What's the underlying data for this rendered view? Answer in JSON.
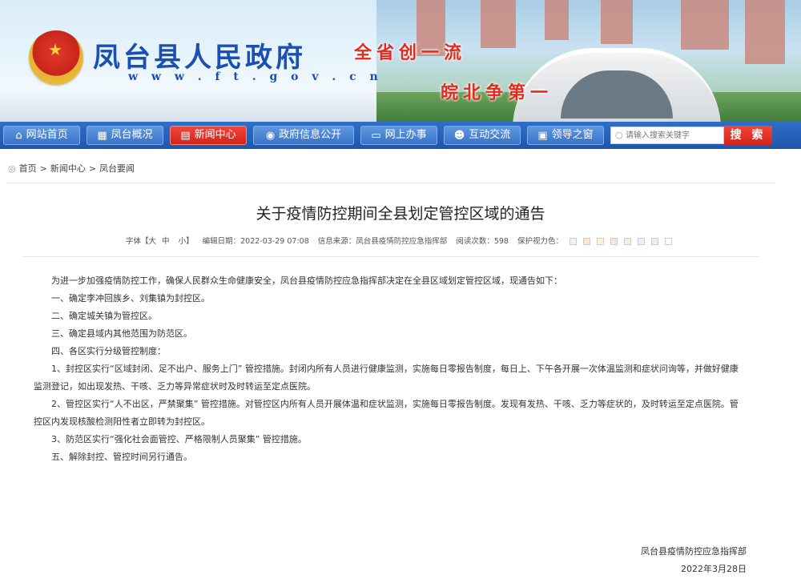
{
  "header": {
    "site_title": "凤台县人民政府",
    "site_url": "w w w . f t . g o v . c n",
    "slogan_line1": "全省创一流",
    "slogan_line2": "皖北争第一"
  },
  "nav": {
    "items": [
      {
        "label": "网站首页",
        "icon": "home-icon"
      },
      {
        "label": "凤台概况",
        "icon": "building-icon"
      },
      {
        "label": "新闻中心",
        "icon": "newspaper-icon",
        "active": true
      },
      {
        "label": "政府信息公开",
        "icon": "compass-icon"
      },
      {
        "label": "网上办事",
        "icon": "monitor-icon"
      },
      {
        "label": "互动交流",
        "icon": "people-icon"
      },
      {
        "label": "领导之窗",
        "icon": "document-icon"
      }
    ],
    "search_placeholder": "请输入搜索关键字",
    "search_button": "搜 索"
  },
  "breadcrumb": {
    "items": [
      "首页",
      "新闻中心",
      "凤台要闻"
    ],
    "separator": ">"
  },
  "article": {
    "title": "关于疫情防控期间全县划定管控区域的通告",
    "meta": {
      "font_label": "字体【大",
      "font_mid": "中",
      "font_small": "小】",
      "edit_date": "编辑日期：2022-03-29 07:08",
      "source": "信息来源：凤台县疫情防控应急指挥部",
      "read_count": "阅读次数：598",
      "eye_color_label": "保护视力色：",
      "eye_colors": [
        "#f2f2f2",
        "#fbe9d6",
        "#fff3d0",
        "#fde0e0",
        "#e6f4e0",
        "#e3f1f8",
        "#ececec",
        "#ffffff"
      ]
    },
    "paragraphs": [
      "为进一步加强疫情防控工作，确保人民群众生命健康安全，凤台县疫情防控应急指挥部决定在全县区域划定管控区域，现通告如下：",
      "一、确定李冲回族乡、刘集镇为封控区。",
      "二、确定城关镇为管控区。",
      "三、确定县域内其他范围为防范区。",
      "四、各区实行分级管控制度：",
      "1、封控区实行“区域封闭、足不出户、服务上门” 管控措施。封闭内所有人员进行健康监测，实施每日零报告制度，每日上、下午各开展一次体温监测和症状问询等，并做好健康监测登记，如出现发热、干咳、乏力等异常症状时及时转运至定点医院。",
      "2、管控区实行“人不出区，严禁聚集” 管控措施。对管控区内所有人员开展体温和症状监测，实施每日零报告制度。发现有发热、干咳、乏力等症状的，及时转运至定点医院。管控区内发现核酸检测阳性者立即转为封控区。",
      "3、防范区实行“强化社会面管控、严格限制人员聚集” 管控措施。",
      "五、解除封控、管控时间另行通告。"
    ],
    "signature": "凤台县疫情防控应急指挥部",
    "date": "2022年3月28日"
  }
}
